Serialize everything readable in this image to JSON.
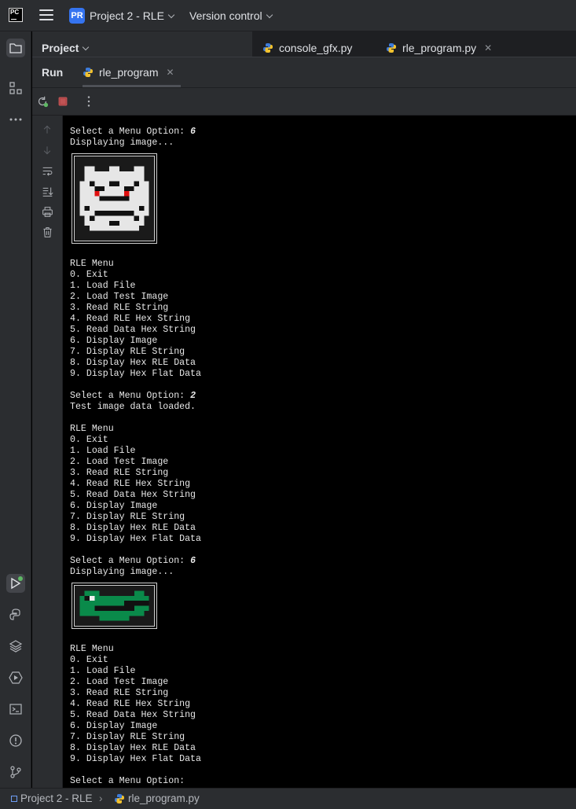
{
  "titlebar": {
    "logo_text": "PC",
    "project_badge": "PR",
    "project_name": "Project 2 - RLE",
    "vcs_label": "Version control"
  },
  "project_panel": {
    "title": "Project"
  },
  "editor_tabs": [
    {
      "label": "console_gfx.py",
      "icon": "python-icon"
    },
    {
      "label": "rle_program.py",
      "icon": "python-icon",
      "closable": true
    }
  ],
  "run_window": {
    "title": "Run",
    "tab_label": "rle_program"
  },
  "console": {
    "lines": [
      {
        "text": "Select a Menu Option: ",
        "input": "6"
      },
      {
        "text": "Displaying image..."
      },
      {
        "text": "RLE Menu"
      },
      {
        "text": "0. Exit"
      },
      {
        "text": "1. Load File"
      },
      {
        "text": "2. Load Test Image"
      },
      {
        "text": "3. Read RLE String"
      },
      {
        "text": "4. Read RLE Hex String"
      },
      {
        "text": "5. Read Data Hex String"
      },
      {
        "text": "6. Display Image"
      },
      {
        "text": "7. Display RLE String"
      },
      {
        "text": "8. Display Hex RLE Data"
      },
      {
        "text": "9. Display Hex Flat Data"
      },
      {
        "text": "Select a Menu Option: ",
        "input": "2"
      },
      {
        "text": "Test image data loaded."
      },
      {
        "text": "RLE Menu"
      },
      {
        "text": "0. Exit"
      },
      {
        "text": "1. Load File"
      },
      {
        "text": "2. Load Test Image"
      },
      {
        "text": "3. Read RLE String"
      },
      {
        "text": "4. Read RLE Hex String"
      },
      {
        "text": "5. Read Data Hex String"
      },
      {
        "text": "6. Display Image"
      },
      {
        "text": "7. Display RLE String"
      },
      {
        "text": "8. Display Hex RLE Data"
      },
      {
        "text": "9. Display Hex Flat Data"
      },
      {
        "text": "Select a Menu Option: ",
        "input": "6"
      },
      {
        "text": "Displaying image..."
      },
      {
        "text": "RLE Menu"
      },
      {
        "text": "0. Exit"
      },
      {
        "text": "1. Load File"
      },
      {
        "text": "2. Load Test Image"
      },
      {
        "text": "3. Read RLE String"
      },
      {
        "text": "4. Read RLE Hex String"
      },
      {
        "text": "5. Read Data Hex String"
      },
      {
        "text": "6. Display Image"
      },
      {
        "text": "7. Display RLE String"
      },
      {
        "text": "8. Display Hex RLE Data"
      },
      {
        "text": "9. Display Hex Flat Data"
      },
      {
        "text": "Select a Menu Option: "
      }
    ]
  },
  "statusbar": {
    "project": "Project 2 - RLE",
    "file": "rle_program.py"
  },
  "colors": {
    "accent": "#3574f0",
    "panel_bg": "#2b2d30",
    "console_bg": "#000000",
    "stop_red": "#db5c5c",
    "rerun_green": "#5fb865",
    "gator_green": "#0a8a4a",
    "eye_red": "#e01010"
  }
}
